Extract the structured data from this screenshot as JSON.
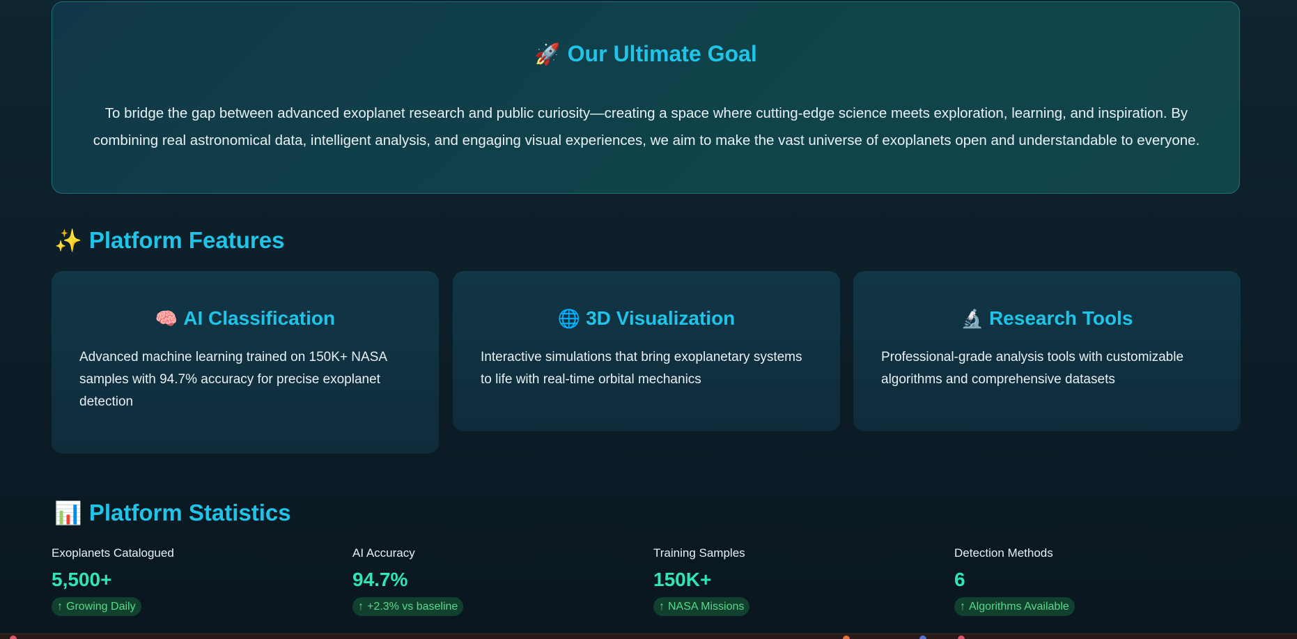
{
  "goal": {
    "icon": "rocket-icon",
    "emoji": "🚀",
    "title": "Our Ultimate Goal",
    "text": "To bridge the gap between advanced exoplanet research and public curiosity—creating a space where cutting-edge science meets exploration, learning, and inspiration. By combining real astronomical data, intelligent analysis, and engaging visual experiences, we aim to make the vast universe of exoplanets open and understandable to everyone."
  },
  "features": {
    "icon": "sparkles-icon",
    "emoji": "✨",
    "title": "Platform Features",
    "items": [
      {
        "icon": "brain-icon",
        "emoji": "🧠",
        "title": "AI Classification",
        "desc": "Advanced machine learning trained on 150K+ NASA samples with 94.7% accuracy for precise exoplanet detection"
      },
      {
        "icon": "globe-icon",
        "emoji": "🌐",
        "title": "3D Visualization",
        "desc": "Interactive simulations that bring exoplanetary systems to life with real-time orbital mechanics"
      },
      {
        "icon": "microscope-icon",
        "emoji": "🔬",
        "title": "Research Tools",
        "desc": "Professional-grade analysis tools with customizable algorithms and comprehensive datasets"
      }
    ]
  },
  "stats": {
    "icon": "bar-chart-icon",
    "emoji": "📊",
    "title": "Platform Statistics",
    "items": [
      {
        "label": "Exoplanets Catalogued",
        "value": "5,500+",
        "delta": "Growing Daily"
      },
      {
        "label": "AI Accuracy",
        "value": "94.7%",
        "delta": "+2.3% vs baseline"
      },
      {
        "label": "Training Samples",
        "value": "150K+",
        "delta": "NASA Missions"
      },
      {
        "label": "Detection Methods",
        "value": "6",
        "delta": "Algorithms Available"
      }
    ]
  },
  "colors": {
    "accent": "#20c4e8",
    "metric": "#2ee6b8",
    "delta_text": "#57d98a",
    "delta_bg": "#12402f"
  }
}
